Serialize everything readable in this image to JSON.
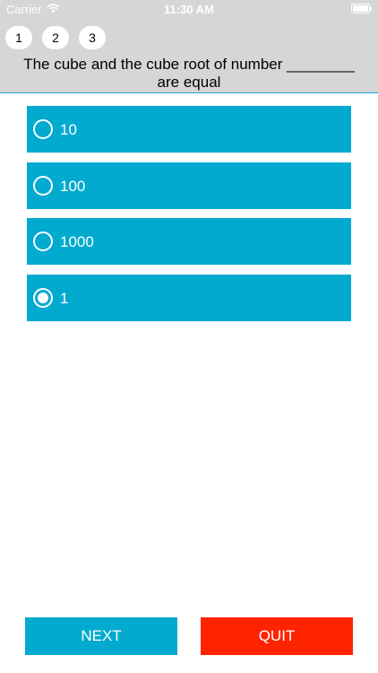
{
  "status_bar": {
    "carrier": "Carrier",
    "time": "11:30 AM"
  },
  "question_nav": [
    "1",
    "2",
    "3"
  ],
  "question": {
    "text": "The cube and the cube root of number ________ are equal"
  },
  "options": [
    {
      "label": "10",
      "selected": false
    },
    {
      "label": "100",
      "selected": false
    },
    {
      "label": "1000",
      "selected": false
    },
    {
      "label": "1",
      "selected": true
    }
  ],
  "buttons": {
    "next_label": "NEXT",
    "quit_label": "QUIT"
  },
  "colors": {
    "accent": "#03aacf",
    "quit": "#fe2400",
    "header_bg": "#d6d6d6"
  }
}
